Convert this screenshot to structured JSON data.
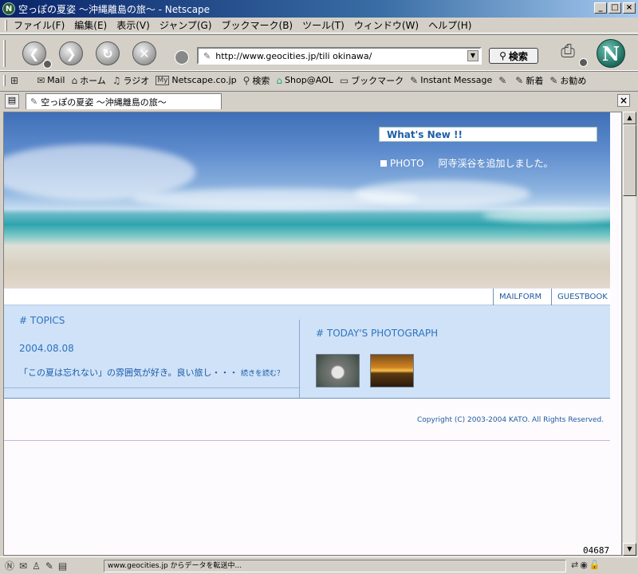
{
  "window": {
    "title": "空っぽの夏姿 〜沖縄離島の旅〜 - Netscape",
    "app_icon": "N",
    "minimize": "_",
    "maximize": "□",
    "close": "×"
  },
  "menu": [
    "ファイル(F)",
    "編集(E)",
    "表示(V)",
    "ジャンプ(G)",
    "ブックマーク(B)",
    "ツール(T)",
    "ウィンドウ(W)",
    "ヘルプ(H)"
  ],
  "nav": {
    "back_icon": "back-icon",
    "forward_icon": "forward-icon",
    "reload_icon": "reload-icon",
    "stop_icon": "stop-icon",
    "url": "http://www.geocities.jp/tili okinawa/",
    "search_label": "検索",
    "logo": "N"
  },
  "bookmarks": [
    {
      "icon": "✉",
      "label": "Mail"
    },
    {
      "icon": "⌂",
      "label": "ホーム"
    },
    {
      "icon": "♫",
      "label": "ラジオ"
    },
    {
      "icon": "My",
      "label": "Netscape.co.jp"
    },
    {
      "icon": "⚲",
      "label": "検索"
    },
    {
      "icon": "⌂",
      "label": "Shop@AOL"
    },
    {
      "icon": "▭",
      "label": "ブックマーク"
    },
    {
      "icon": "✎",
      "label": "Instant Message"
    },
    {
      "icon": "✎",
      "label": ""
    },
    {
      "icon": "✎",
      "label": "新着"
    },
    {
      "icon": "✎",
      "label": "お勧め"
    }
  ],
  "tab": {
    "label": "空っぽの夏姿 〜沖縄離島の旅〜",
    "close": "×"
  },
  "page": {
    "whats_new": "What's New !!",
    "news_item": "PHOTO",
    "news_text": "阿寺渓谷を追加しました。",
    "links": [
      "MAILFORM",
      "GUESTBOOK"
    ],
    "topics_heading": "#  TOPICS",
    "topics_date": "2004.08.08",
    "topics_text": "「この夏は忘れない」の雰囲気が好き。良い旅し・・・",
    "topics_more": "続きを読む？",
    "photo_heading": "#  TODAY'S PHOTOGRAPH",
    "copyright": "Copyright (C) 2003-2004 KATO. All Rights Reserved.",
    "counter": "04687"
  },
  "status": {
    "text": "www.geocities.jp からデータを転送中..."
  }
}
